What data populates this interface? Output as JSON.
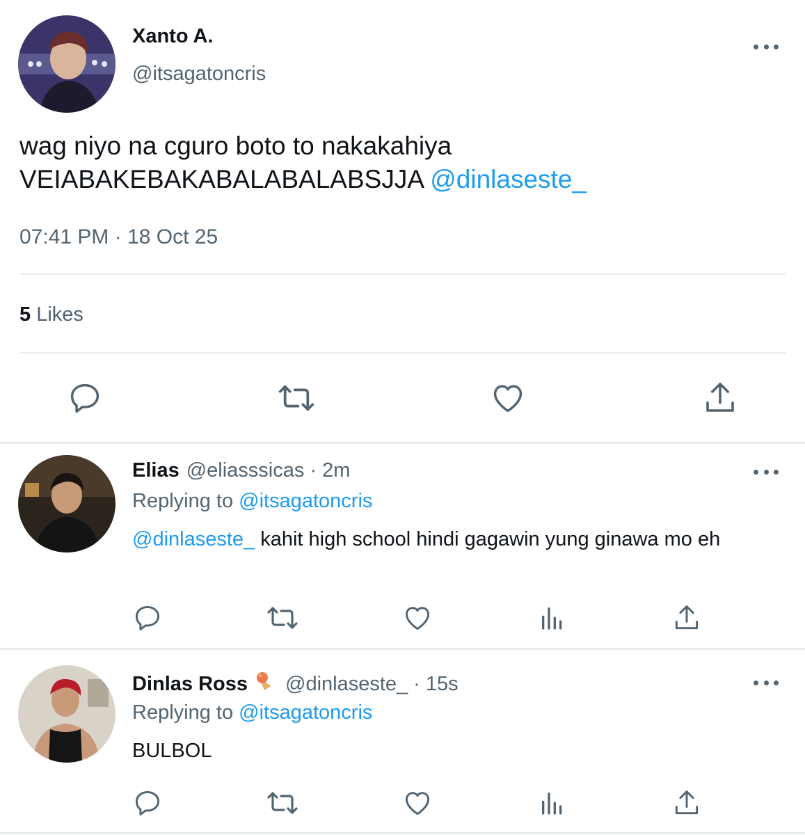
{
  "main_tweet": {
    "author_name": "Xanto A.",
    "author_handle": "@itsagatoncris",
    "text": "wag niyo na cguro boto to nakakahiya VEIABAKEBAKABALABALABSJJA ",
    "mention": "@dinlaseste_",
    "timestamp": "07:41 PM · 18 Oct 25",
    "likes_count": "5",
    "likes_label": "Likes",
    "actions": [
      "reply-icon",
      "retweet-icon",
      "like-icon",
      "share-icon"
    ]
  },
  "replies": [
    {
      "name": "Elias",
      "handle": "@eliasssicas",
      "time": "· 2m",
      "replying_label": "Replying to ",
      "replying_to": "@itsagatoncris",
      "mention": "@dinlaseste_",
      "text": " kahit high school hindi gagawin yung ginawa mo eh"
    },
    {
      "name": "Dinlas Ross",
      "emoji": "ice-cream-emoji",
      "handle": "@dinlaseste_",
      "time": "· 15s",
      "replying_label": "Replying to ",
      "replying_to": "@itsagatoncris",
      "text": "BULBOL"
    }
  ],
  "colors": {
    "link": "#1d9bf0",
    "secondary_text": "#536471",
    "icon": "#536471",
    "divider": "#e8ebed"
  }
}
